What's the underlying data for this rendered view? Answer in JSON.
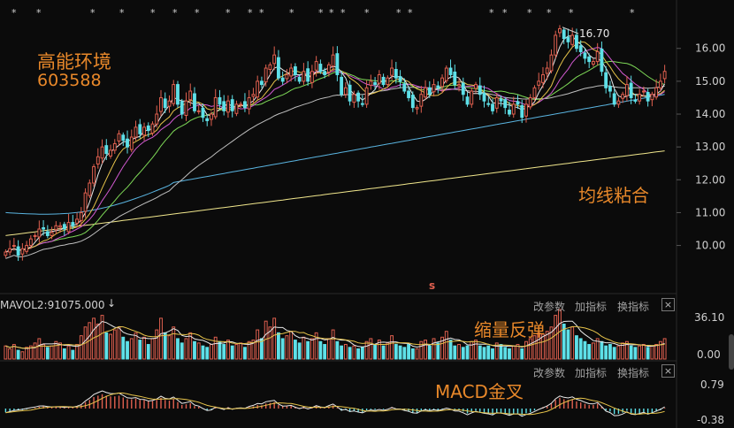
{
  "annotations": {
    "title_line1": "高能环境",
    "title_line2": "603588",
    "ma_note": "均线粘合",
    "vol_note": "缩量反弹",
    "macd_note": "MACD金叉",
    "peak_label": "16.70",
    "center_marker": "s"
  },
  "volume_panel": {
    "header": "MAVOL2:91075.000",
    "buttons": [
      "改参数",
      "加指标",
      "换指标"
    ],
    "close_glyph": "×",
    "scale": [
      "36.10",
      "0.00"
    ]
  },
  "macd_panel": {
    "buttons": [
      "改参数",
      "加指标",
      "换指标"
    ],
    "close_glyph": "×",
    "scale": [
      "0.79",
      "-0.38"
    ]
  },
  "colors": {
    "up": "#e0604f",
    "down": "#5ee0e8",
    "ma5": "#e8e8e8",
    "ma10": "#e6c34a",
    "ma20": "#d25ad2",
    "ma30": "#7ed957",
    "ma60": "#bfbfbf",
    "ma120": "#5ab4e0",
    "ma250": "#f0e68c",
    "annotation": "#e8882a"
  },
  "chart_data": {
    "type": "candlestick",
    "y_ticks": [
      10.0,
      11.0,
      12.0,
      13.0,
      14.0,
      15.0,
      16.0
    ],
    "y_tick_labels": [
      "10.00",
      "11.00",
      "12.00",
      "13.00",
      "14.00",
      "15.00",
      "16.00"
    ],
    "ylim": [
      9.45,
      16.72
    ],
    "peak_value": 16.7,
    "close": [
      9.8,
      9.9,
      10.0,
      9.7,
      9.9,
      10.0,
      10.2,
      10.3,
      10.5,
      10.5,
      10.3,
      10.4,
      10.6,
      10.6,
      10.5,
      10.7,
      10.6,
      10.8,
      11.0,
      11.6,
      11.9,
      12.4,
      12.7,
      13.0,
      12.8,
      12.9,
      13.1,
      13.4,
      13.2,
      13.0,
      13.3,
      13.6,
      13.4,
      13.6,
      13.5,
      13.7,
      14.0,
      14.5,
      14.2,
      14.4,
      14.9,
      14.3,
      14.0,
      14.4,
      14.7,
      14.1,
      14.1,
      13.9,
      13.8,
      14.0,
      14.5,
      14.3,
      14.1,
      14.4,
      14.1,
      14.3,
      14.3,
      14.2,
      14.5,
      14.6,
      15.0,
      14.9,
      15.4,
      15.5,
      15.8,
      15.1,
      15.0,
      15.2,
      15.4,
      15.2,
      15.0,
      15.3,
      15.0,
      15.3,
      15.6,
      15.3,
      15.2,
      15.5,
      15.8,
      15.2,
      14.6,
      14.8,
      14.4,
      14.6,
      14.4,
      14.3,
      14.8,
      15.0,
      14.9,
      15.2,
      14.9,
      15.1,
      15.4,
      15.1,
      15.0,
      14.7,
      14.5,
      14.2,
      14.2,
      14.6,
      14.8,
      14.6,
      14.9,
      14.8,
      15.1,
      15.4,
      15.2,
      14.9,
      14.9,
      14.6,
      14.3,
      14.7,
      14.9,
      14.6,
      14.4,
      14.3,
      14.1,
      14.5,
      14.4,
      14.2,
      14.0,
      14.3,
      14.3,
      13.9,
      14.3,
      14.5,
      14.8,
      15.0,
      15.2,
      15.4,
      15.8,
      16.4,
      16.6,
      16.3,
      16.2,
      16.4,
      16.0,
      15.9,
      15.7,
      15.6,
      15.6,
      15.9,
      15.3,
      14.8,
      14.7,
      14.3,
      14.4,
      14.6,
      14.9,
      14.5,
      14.4,
      14.6,
      14.7,
      14.4,
      14.6,
      14.8,
      15.0,
      15.3
    ],
    "volume": [
      9,
      7,
      10,
      6,
      5,
      8,
      9,
      11,
      14,
      10,
      8,
      9,
      12,
      11,
      7,
      9,
      6,
      10,
      16,
      22,
      25,
      28,
      24,
      30,
      18,
      17,
      20,
      22,
      15,
      12,
      14,
      18,
      13,
      15,
      10,
      14,
      20,
      28,
      18,
      16,
      22,
      14,
      11,
      14,
      18,
      12,
      11,
      9,
      8,
      10,
      15,
      12,
      10,
      13,
      9,
      10,
      11,
      8,
      12,
      13,
      20,
      14,
      26,
      22,
      28,
      18,
      14,
      16,
      19,
      13,
      11,
      15,
      12,
      14,
      18,
      12,
      10,
      14,
      20,
      12,
      9,
      10,
      8,
      9,
      7,
      8,
      12,
      14,
      10,
      13,
      9,
      11,
      16,
      10,
      9,
      8,
      10,
      7,
      7,
      12,
      13,
      9,
      14,
      11,
      15,
      19,
      13,
      9,
      10,
      8,
      9,
      12,
      13,
      9,
      8,
      9,
      7,
      11,
      10,
      8,
      7,
      9,
      10,
      7,
      12,
      14,
      16,
      18,
      17,
      19,
      22,
      30,
      34,
      24,
      20,
      22,
      16,
      14,
      12,
      10,
      11,
      14,
      12,
      9,
      10,
      8,
      9,
      11,
      12,
      9,
      8,
      9,
      10,
      8,
      9,
      10,
      12,
      14
    ],
    "macd": [
      -0.1,
      -0.08,
      -0.06,
      -0.05,
      -0.04,
      -0.02,
      0.0,
      0.02,
      0.05,
      0.06,
      0.05,
      0.05,
      0.06,
      0.06,
      0.05,
      0.06,
      0.05,
      0.07,
      0.1,
      0.18,
      0.24,
      0.32,
      0.36,
      0.4,
      0.36,
      0.34,
      0.34,
      0.36,
      0.31,
      0.26,
      0.26,
      0.28,
      0.24,
      0.24,
      0.2,
      0.21,
      0.24,
      0.3,
      0.24,
      0.22,
      0.26,
      0.18,
      0.1,
      0.12,
      0.15,
      0.07,
      0.05,
      0.0,
      -0.04,
      -0.02,
      0.05,
      0.03,
      0.0,
      0.04,
      0.0,
      0.02,
      0.02,
      0.0,
      0.04,
      0.06,
      0.1,
      0.09,
      0.14,
      0.16,
      0.18,
      0.1,
      0.06,
      0.07,
      0.09,
      0.05,
      0.02,
      0.05,
      0.01,
      0.04,
      0.08,
      0.04,
      0.02,
      0.06,
      0.09,
      0.02,
      -0.06,
      -0.04,
      -0.09,
      -0.07,
      -0.09,
      -0.1,
      -0.05,
      -0.02,
      -0.03,
      0.0,
      -0.02,
      0.0,
      0.04,
      0.0,
      -0.01,
      -0.05,
      -0.08,
      -0.12,
      -0.13,
      -0.08,
      -0.05,
      -0.07,
      -0.04,
      -0.05,
      -0.02,
      0.02,
      0.0,
      -0.04,
      -0.04,
      -0.08,
      -0.13,
      -0.09,
      -0.06,
      -0.09,
      -0.12,
      -0.14,
      -0.17,
      -0.12,
      -0.13,
      -0.15,
      -0.18,
      -0.14,
      -0.13,
      -0.18,
      -0.13,
      -0.1,
      -0.05,
      0.0,
      0.04,
      0.08,
      0.14,
      0.24,
      0.3,
      0.26,
      0.24,
      0.26,
      0.2,
      0.17,
      0.13,
      0.1,
      0.1,
      0.14,
      0.05,
      -0.05,
      -0.08,
      -0.15,
      -0.14,
      -0.11,
      -0.06,
      -0.12,
      -0.14,
      -0.12,
      -0.1,
      -0.15,
      -0.12,
      -0.08,
      -0.04,
      0.02
    ]
  }
}
